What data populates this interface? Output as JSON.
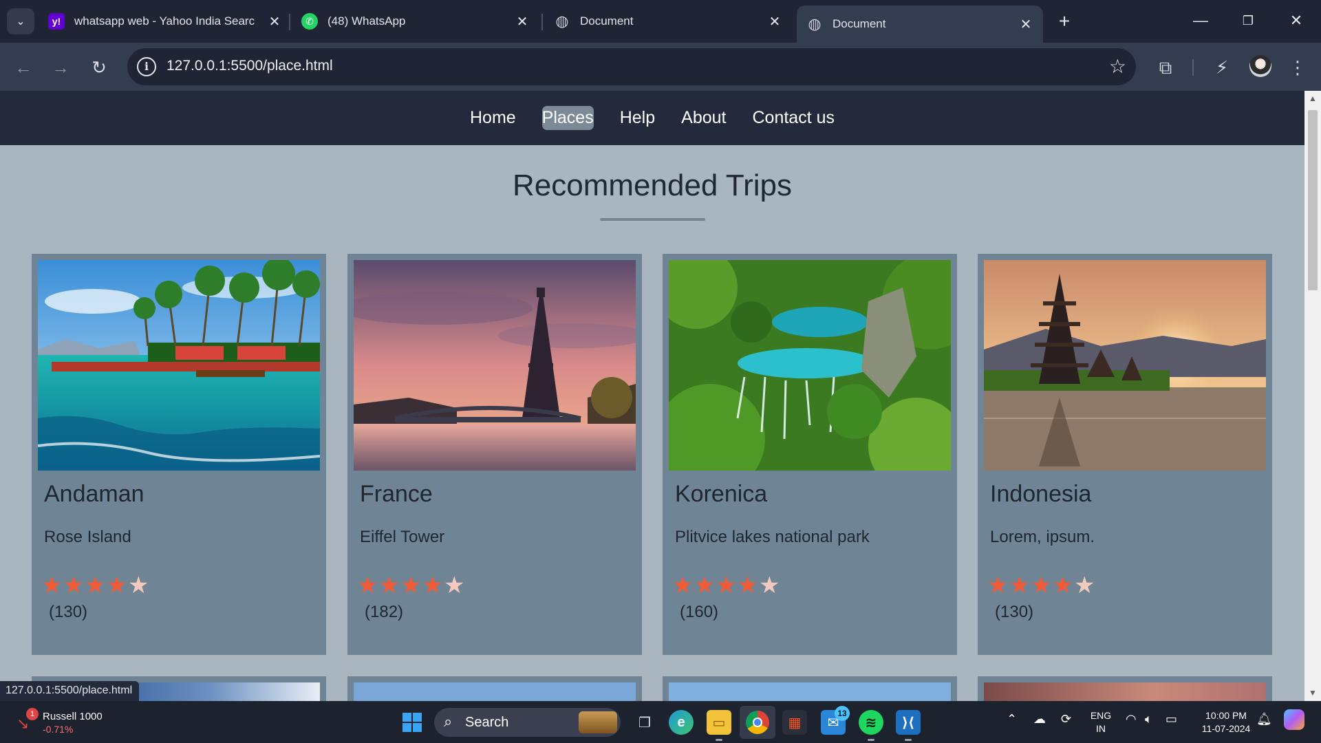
{
  "browser": {
    "tabs": [
      {
        "title": "whatsapp web - Yahoo India Searc",
        "icon": "yahoo-icon",
        "favicon_text": "y!"
      },
      {
        "title": "(48) WhatsApp",
        "icon": "whatsapp-icon",
        "favicon_text": "✆"
      },
      {
        "title": "Document",
        "icon": "globe-icon",
        "favicon_text": "◍"
      },
      {
        "title": "Document",
        "icon": "globe-icon",
        "favicon_text": "◍",
        "active": true
      }
    ],
    "url": "127.0.0.1:5500/place.html",
    "status_url": "127.0.0.1:5500/place.html"
  },
  "site": {
    "nav": [
      {
        "label": "Home"
      },
      {
        "label": "Places",
        "active": true
      },
      {
        "label": "Help"
      },
      {
        "label": "About"
      },
      {
        "label": "Contact us"
      }
    ],
    "heading": "Recommended Trips",
    "cards": [
      {
        "name": "Andaman",
        "subtitle": "Rose Island",
        "rating": 4,
        "max_rating": 5,
        "reviews": "(130)",
        "image": "tropical-beach-image"
      },
      {
        "name": "France",
        "subtitle": "Eiffel Tower",
        "rating": 4,
        "max_rating": 5,
        "reviews": "(182)",
        "image": "eiffel-tower-sunset-image"
      },
      {
        "name": "Korenica",
        "subtitle": "Plitvice lakes national park",
        "rating": 4,
        "max_rating": 5,
        "reviews": "(160)",
        "image": "waterfall-lakes-image"
      },
      {
        "name": "Indonesia",
        "subtitle": "Lorem, ipsum.",
        "rating": 4,
        "max_rating": 5,
        "reviews": "(130)",
        "image": "temple-lake-sunset-image"
      }
    ]
  },
  "taskbar": {
    "stock_name": "Russell 1000",
    "stock_change": "-0.71%",
    "stock_badge": "1",
    "search_label": "Search",
    "mail_badge": "13",
    "lang_line1": "ENG",
    "lang_line2": "IN",
    "time": "10:00 PM",
    "date": "11-07-2024"
  },
  "colors": {
    "nav_bg": "#222a3b",
    "page_bg": "#a9b6c0",
    "card_bg": "#6f8494",
    "star_on": "#f25a35",
    "star_off": "#f3c9bd"
  }
}
